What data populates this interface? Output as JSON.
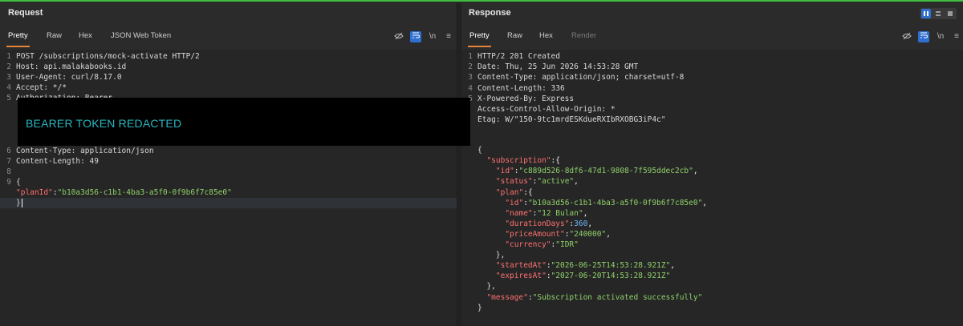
{
  "request": {
    "title": "Request",
    "tabs": [
      "Pretty",
      "Raw",
      "Hex",
      "JSON Web Token"
    ],
    "redaction_label": "BEARER TOKEN REDACTED",
    "lines": [
      {
        "n": "1",
        "text": "POST /subscriptions/mock-activate HTTP/2"
      },
      {
        "n": "2",
        "text": "Host: api.malakabooks.id"
      },
      {
        "n": "3",
        "text": "User-Agent: curl/8.17.0"
      },
      {
        "n": "4",
        "text": "Accept: */*"
      },
      {
        "n": "5",
        "text": "Authorization: Bearer"
      },
      {
        "n": "6",
        "text": "Content-Type: application/json"
      },
      {
        "n": "7",
        "text": "Content-Length: 49"
      },
      {
        "n": "8",
        "text": ""
      },
      {
        "n": "9",
        "text": "{"
      },
      {
        "n": "",
        "key": "\"planId\"",
        "sep": ":",
        "value": "\"b10a3d56-c1b1-4ba3-a5f0-0f9b6f7c85e0\""
      },
      {
        "n": "",
        "text": "}"
      }
    ]
  },
  "response": {
    "title": "Response",
    "tabs": [
      "Pretty",
      "Raw",
      "Hex",
      "Render"
    ],
    "lines": [
      {
        "n": "1",
        "text": "HTTP/2 201 Created"
      },
      {
        "n": "2",
        "text": "Date: Thu, 25 Jun 2026 14:53:28 GMT"
      },
      {
        "n": "3",
        "text": "Content-Type: application/json; charset=utf-8"
      },
      {
        "n": "4",
        "text": "Content-Length: 336"
      },
      {
        "n": "5",
        "text": "X-Powered-By: Express"
      },
      {
        "n": "",
        "text": "Access-Control-Allow-Origin: *"
      },
      {
        "n": "",
        "text": "Etag: W/\"150-9tc1mrdESKdueRXIbRXOBG3iP4c\""
      },
      {
        "n": "",
        "text": ""
      },
      {
        "n": "",
        "text": "{"
      },
      {
        "n": "",
        "indent": "  ",
        "key": "\"subscription\"",
        "sep": ":{"
      },
      {
        "n": "",
        "indent": "    ",
        "key": "\"id\"",
        "sep": ":",
        "value": "\"c889d526-8df6-47d1-9808-7f595ddec2cb\"",
        "tail": ","
      },
      {
        "n": "",
        "indent": "    ",
        "key": "\"status\"",
        "sep": ":",
        "value": "\"active\"",
        "tail": ","
      },
      {
        "n": "",
        "indent": "    ",
        "key": "\"plan\"",
        "sep": ":{"
      },
      {
        "n": "",
        "indent": "      ",
        "key": "\"id\"",
        "sep": ":",
        "value": "\"b10a3d56-c1b1-4ba3-a5f0-0f9b6f7c85e0\"",
        "tail": ","
      },
      {
        "n": "",
        "indent": "      ",
        "key": "\"name\"",
        "sep": ":",
        "value": "\"12 Bulan\"",
        "tail": ","
      },
      {
        "n": "",
        "indent": "      ",
        "key": "\"durationDays\"",
        "sep": ":",
        "num": "360",
        "tail": ","
      },
      {
        "n": "",
        "indent": "      ",
        "key": "\"priceAmount\"",
        "sep": ":",
        "value": "\"240000\"",
        "tail": ","
      },
      {
        "n": "",
        "indent": "      ",
        "key": "\"currency\"",
        "sep": ":",
        "value": "\"IDR\""
      },
      {
        "n": "",
        "indent": "    ",
        "text": "},"
      },
      {
        "n": "",
        "indent": "    ",
        "key": "\"startedAt\"",
        "sep": ":",
        "value": "\"2026-06-25T14:53:28.921Z\"",
        "tail": ","
      },
      {
        "n": "",
        "indent": "    ",
        "key": "\"expiresAt\"",
        "sep": ":",
        "value": "\"2027-06-20T14:53:28.921Z\""
      },
      {
        "n": "",
        "indent": "  ",
        "text": "},"
      },
      {
        "n": "",
        "indent": "  ",
        "key": "\"message\"",
        "sep": ":",
        "value": "\"Subscription activated successfully\""
      },
      {
        "n": "",
        "text": "}"
      }
    ]
  },
  "icons": {
    "hide": "eye-off-icon",
    "wrap": "wrap-icon",
    "newline": "newline-icon",
    "menu": "menu-icon"
  }
}
